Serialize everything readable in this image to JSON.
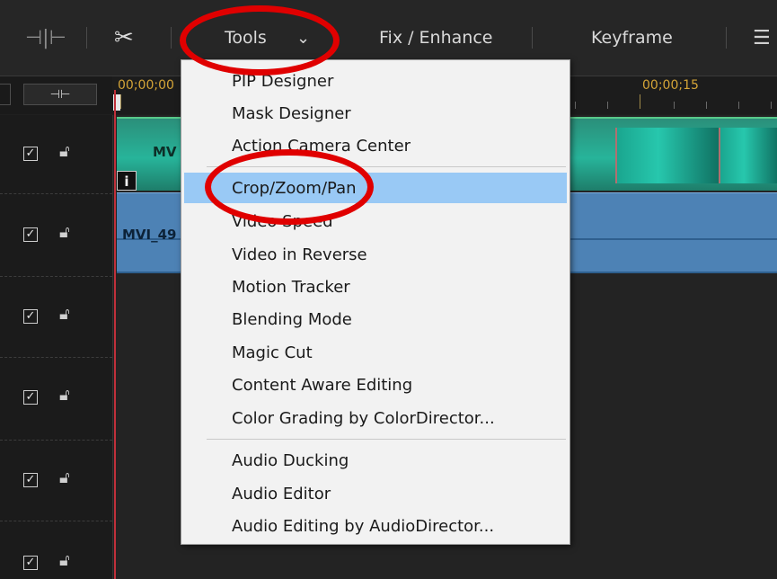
{
  "toolbar": {
    "splitter_icon": "split-marker-icon",
    "scissors_icon": "scissors-icon",
    "tools_label": "Tools",
    "tools_chevron": "⌄",
    "fix_enhance_label": "Fix / Enhance",
    "keyframe_label": "Keyframe",
    "more_icon": "list-menu-icon"
  },
  "ruler": {
    "fit_glyph": "⊣⊢",
    "timecode_start": "00;00;00",
    "timecode_15": "00;00;15"
  },
  "timeline": {
    "video_clip_label": "MV",
    "audio_clip_label": "MVI_49",
    "info_badge": "i"
  },
  "tracks": [
    {
      "checked": true,
      "lock": "unlocked"
    },
    {
      "checked": true,
      "lock": "unlocked"
    },
    {
      "checked": true,
      "lock": "unlocked"
    },
    {
      "checked": true,
      "lock": "unlocked"
    },
    {
      "checked": true,
      "lock": "unlocked"
    },
    {
      "checked": true,
      "lock": "unlocked"
    }
  ],
  "menu": {
    "items": [
      "PIP Designer",
      "Mask Designer",
      "Action Camera Center",
      "Crop/Zoom/Pan",
      "Video Speed",
      "Video in Reverse",
      "Motion Tracker",
      "Blending Mode",
      "Magic Cut",
      "Content Aware Editing",
      "Color Grading by ColorDirector...",
      "Audio Ducking",
      "Audio Editor",
      "Audio Editing by AudioDirector..."
    ],
    "selected": "Crop/Zoom/Pan"
  },
  "colors": {
    "annotation_red": "#e00000",
    "menu_highlight": "#99c9f5",
    "playhead": "#c0303a",
    "timecode": "#d4a437"
  }
}
